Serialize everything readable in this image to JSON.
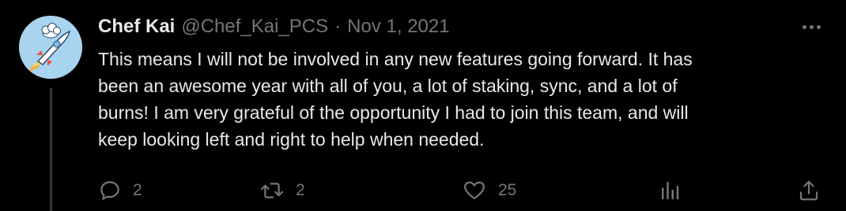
{
  "tweet": {
    "display_name": "Chef Kai",
    "handle": "@Chef_Kai_PCS",
    "separator": "·",
    "date": "Nov 1, 2021",
    "text_lines": [
      "This means I will not be involved in any new features going forward. It has",
      "been an awesome year with all of you, a lot of staking, sync, and a lot of",
      "burns! I am very grateful of the opportunity I had to join this team, and will",
      "keep looking left and right to help when needed."
    ],
    "actions": {
      "reply_count": "2",
      "retweet_count": "2",
      "like_count": "25"
    }
  },
  "icons": {
    "avatar": "rocket-cat-avatar",
    "more": "more-dots-icon",
    "reply": "reply-icon",
    "retweet": "retweet-icon",
    "like": "heart-icon",
    "views": "analytics-icon",
    "share": "share-icon"
  },
  "colors": {
    "background": "#000000",
    "text": "#e7e9ea",
    "muted": "#71767b",
    "thread_line": "#333639",
    "avatar_bg": "#a8d4f0"
  }
}
